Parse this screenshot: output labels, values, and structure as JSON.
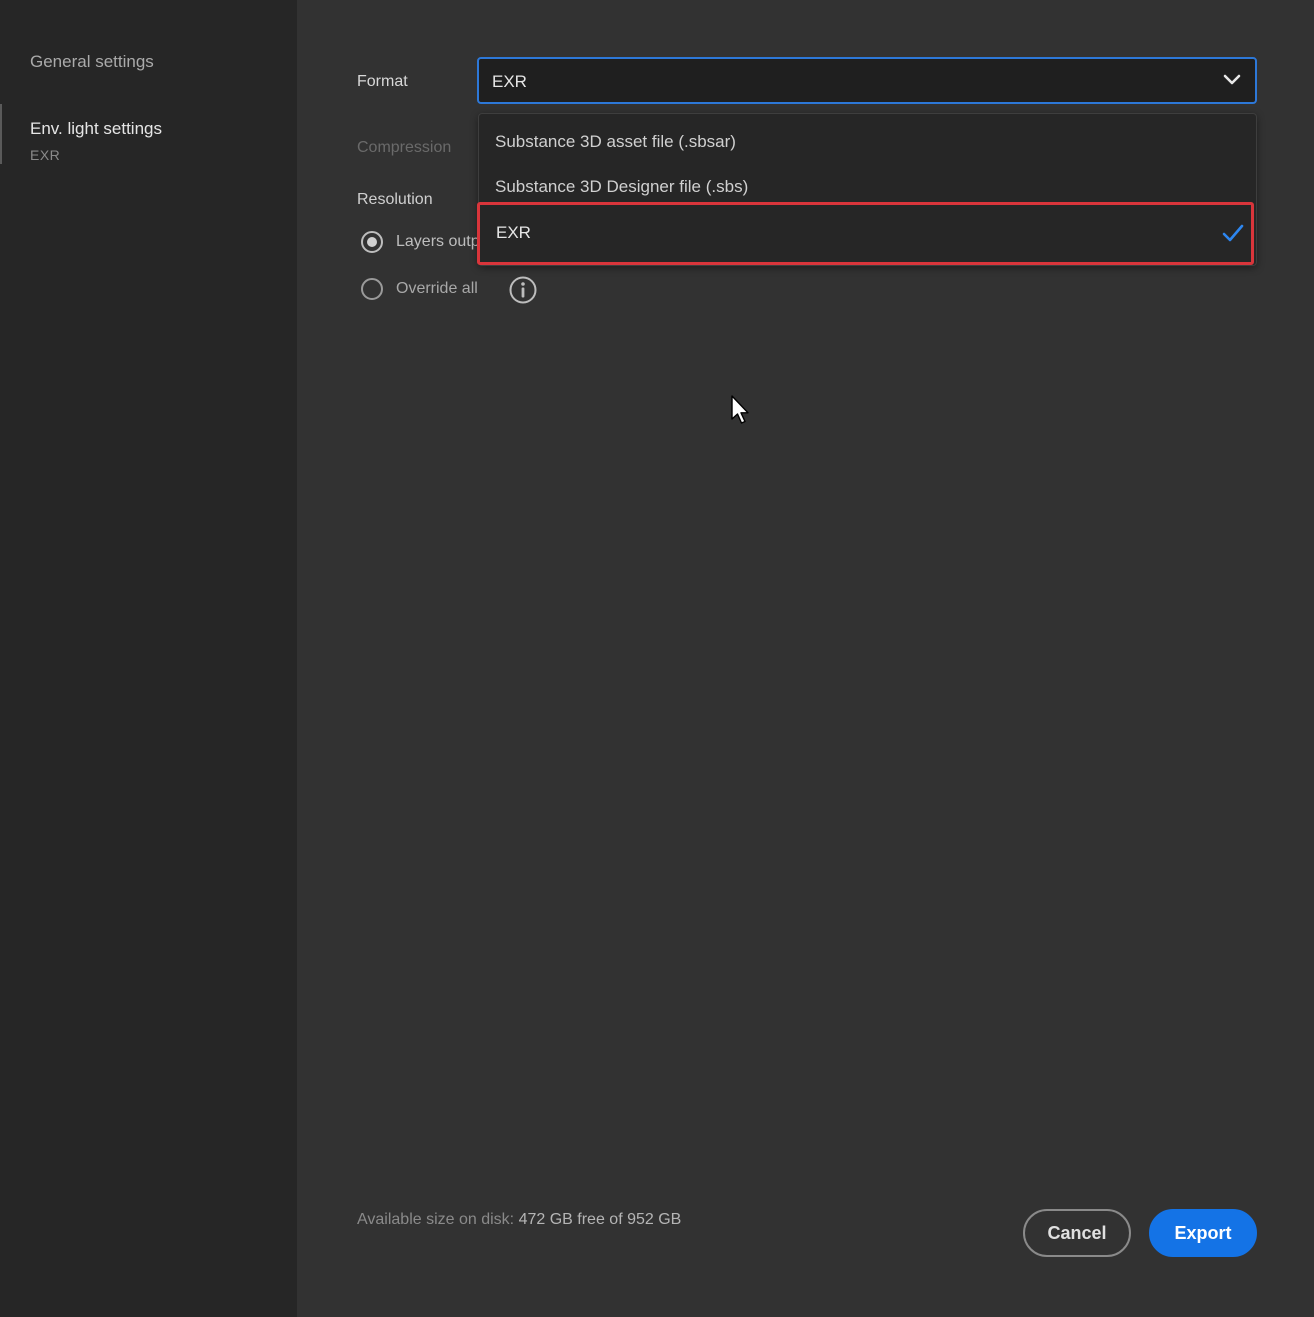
{
  "sidebar": {
    "items": [
      {
        "label": "General settings",
        "sub": ""
      },
      {
        "label": "Env. light settings",
        "sub": "EXR"
      }
    ]
  },
  "form": {
    "format_label": "Format",
    "format_value": "EXR",
    "compression_label": "Compression",
    "resolution_label": "Resolution",
    "radio_layers_label": "Layers outp",
    "radio_override_label": "Override all"
  },
  "dropdown": {
    "options": [
      {
        "label": "Substance 3D asset file (.sbsar)",
        "selected": false
      },
      {
        "label": "Substance 3D Designer file (.sbs)",
        "selected": false
      },
      {
        "label": "EXR",
        "selected": true
      }
    ]
  },
  "footer": {
    "disk_prefix": "Available size on disk:",
    "disk_value": "472 GB free of 952 GB",
    "cancel_label": "Cancel",
    "export_label": "Export"
  },
  "colors": {
    "accent": "#1473e6",
    "highlight_border": "#d9353b",
    "background": "#323232",
    "sidebar_bg": "#262626"
  },
  "icons": [
    "chevron-down-icon",
    "checkmark-icon",
    "info-icon",
    "mouse-cursor"
  ]
}
